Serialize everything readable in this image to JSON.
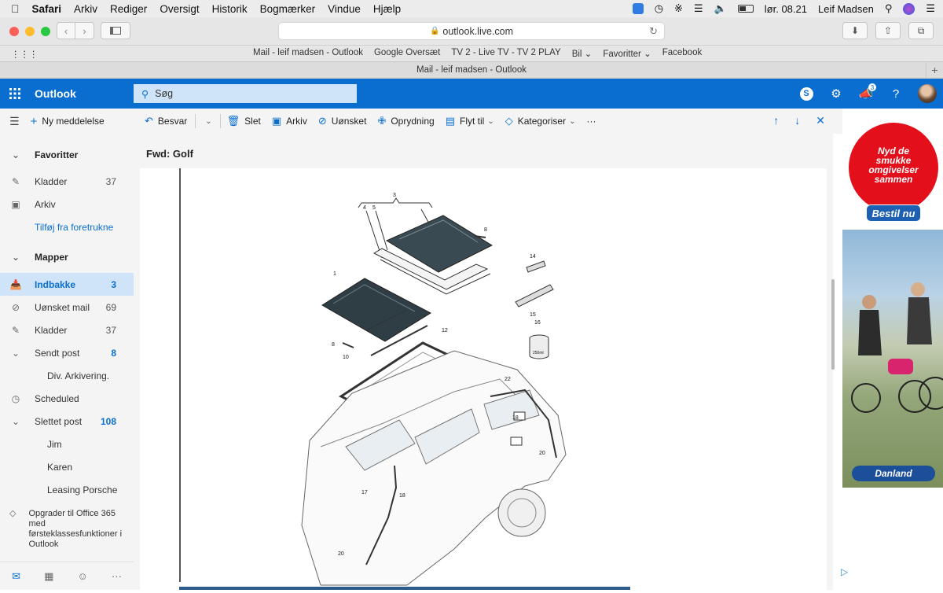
{
  "menubar": {
    "app": "Safari",
    "items": [
      "Arkiv",
      "Rediger",
      "Oversigt",
      "Historik",
      "Bogmærker",
      "Vindue",
      "Hjælp"
    ],
    "clock": "lør. 08.21",
    "user": "Leif Madsen"
  },
  "safari": {
    "url": "outlook.live.com",
    "bookmarks": [
      "Mail - leif madsen - Outlook",
      "Google Oversæt",
      "TV 2 - Live TV - TV 2 PLAY",
      "Bil ⌄",
      "Favoritter ⌄",
      "Facebook"
    ],
    "tab_title": "Mail - leif madsen - Outlook"
  },
  "outlook": {
    "brand": "Outlook",
    "search_placeholder": "Søg",
    "notification_count": "3",
    "new_message": "Ny meddelelse",
    "nav": {
      "favorites_header": "Favoritter",
      "fav_drafts": "Kladder",
      "fav_drafts_count": "37",
      "fav_archive": "Arkiv",
      "add_favorite": "Tilføj fra foretrukne",
      "folders_header": "Mapper",
      "inbox": "Indbakke",
      "inbox_count": "3",
      "junk": "Uønsket mail",
      "junk_count": "69",
      "drafts": "Kladder",
      "drafts_count": "37",
      "sent": "Sendt post",
      "sent_count": "8",
      "sent_sub": "Div. Arkivering.",
      "scheduled": "Scheduled",
      "deleted": "Slettet post",
      "deleted_count": "108",
      "deleted_sub1": "Jim",
      "deleted_sub2": "Karen",
      "deleted_sub3": "Leasing Porsche",
      "upgrade": "Opgrader til Office 365 med førsteklassesfunktioner i Outlook"
    },
    "commands": {
      "reply": "Besvar",
      "delete": "Slet",
      "archive": "Arkiv",
      "junk": "Uønsket",
      "sweep": "Oprydning",
      "move": "Flyt til",
      "categorize": "Kategoriser",
      "more": "···"
    },
    "subject": "Fwd: Golf"
  },
  "diagram_labels": [
    "3",
    "4",
    "5",
    "8",
    "1",
    "14",
    "15",
    "16",
    "8",
    "10",
    "12",
    "22",
    "18",
    "20",
    "17",
    "18",
    "20",
    "250ml"
  ],
  "ad": {
    "headline_1": "Nyd de",
    "headline_2": "smukke",
    "headline_3": "omgivelser",
    "headline_4": "sammen",
    "cta": "Bestil nu",
    "logo": "Danland"
  },
  "colors": {
    "outlook_blue": "#0a6ed1",
    "ad_red": "#e3101b"
  }
}
